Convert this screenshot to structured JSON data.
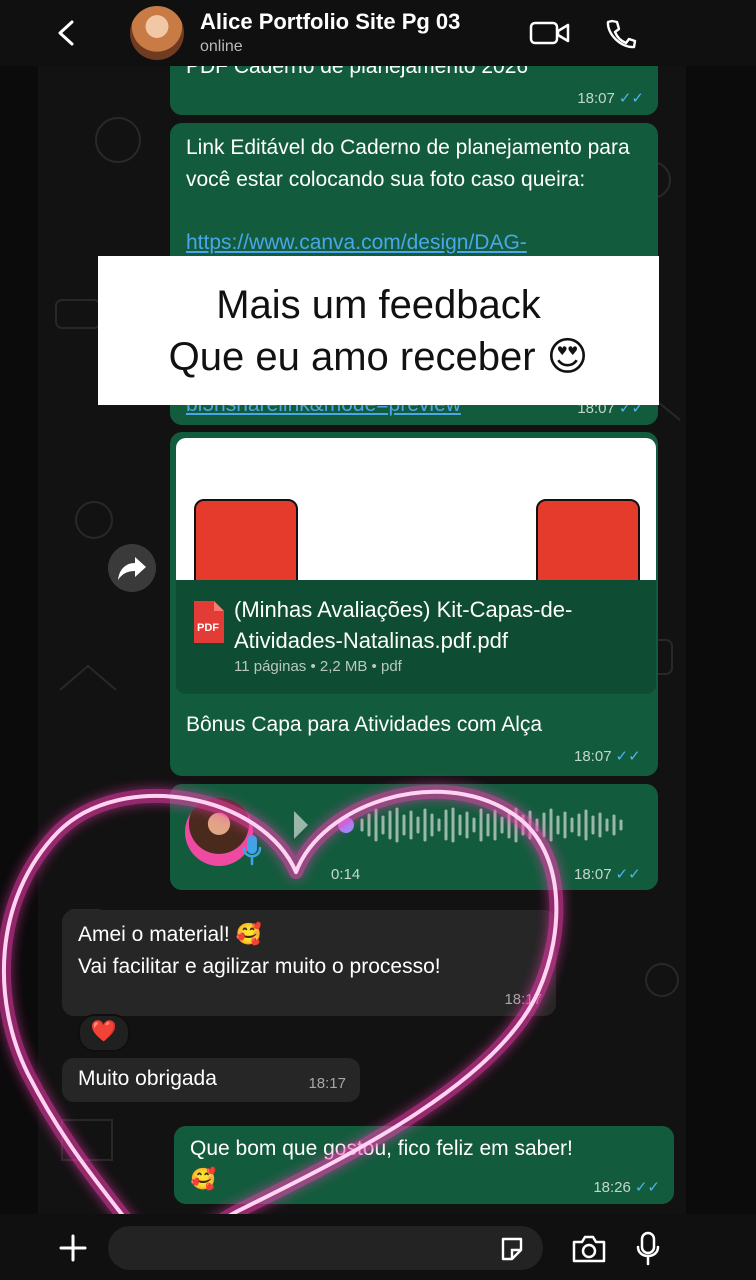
{
  "header": {
    "contact_name": "Alice Portfolio Site Pg 03",
    "status": "online"
  },
  "messages": [
    {
      "text": "PDF Caderno de planejamento 2026",
      "time": "18:07"
    },
    {
      "text": "Link Editável do Caderno de planejamento para você estar colocando sua foto caso queira:",
      "link": "https://www.canva.com/design/DAG-",
      "link_tail": "bl5hsharelink&mode=preview",
      "time": "18:07"
    },
    {
      "document_name": "(Minhas Avaliações)  Kit-Capas-de-Atividades-Natalinas.pdf.pdf",
      "document_meta": "11 páginas • 2,2 MB • pdf",
      "document_icon_label": "PDF",
      "caption": "Bônus Capa para Atividades com Alça",
      "time": "18:07"
    },
    {
      "audio_duration": "0:14",
      "time": "18:07"
    },
    {
      "line1": "Amei o material! 🥰",
      "line2": "Vai facilitar e agilizar muito o processo!",
      "time": "18:17",
      "reaction": "❤️"
    },
    {
      "text": "Muito obrigada",
      "time": "18:17"
    },
    {
      "line1": "Que bom que gostou, fico feliz em saber!",
      "line2": "🥰",
      "time": "18:26"
    }
  ],
  "overlay": {
    "line1": "Mais um feedback",
    "line2": "Que eu amo receber 😍"
  },
  "icons": {
    "back": "chevron-left-icon",
    "video": "video-call-icon",
    "phone": "phone-icon",
    "forward": "forward-icon",
    "plus": "plus-icon",
    "sticker": "sticker-icon",
    "camera": "camera-icon",
    "mic": "microphone-icon"
  },
  "colors": {
    "outgoing_bubble": "#125c3d",
    "incoming_bubble": "#262626",
    "tick": "#4fb6ec",
    "heart": "#ff3db8"
  }
}
